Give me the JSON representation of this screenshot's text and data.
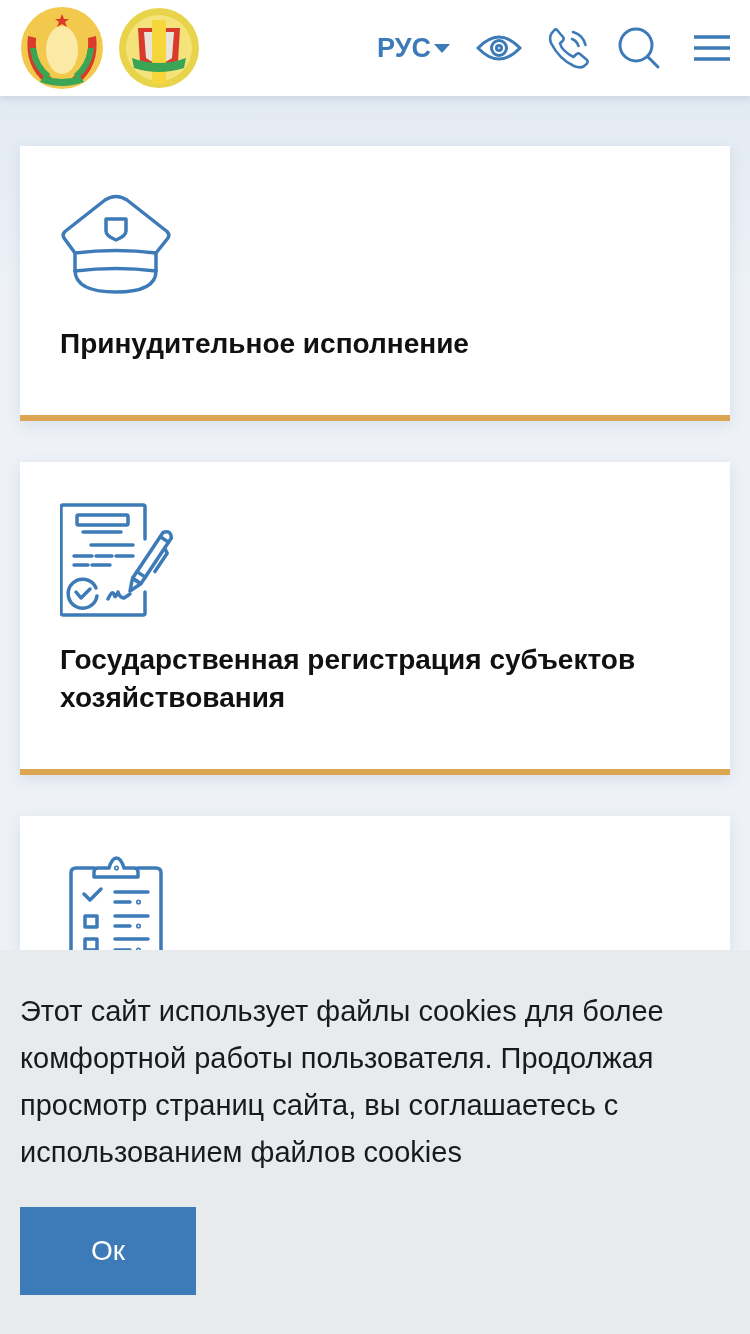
{
  "header": {
    "language": "РУС"
  },
  "cards": [
    {
      "kind": "cap",
      "title": "Принудительное исполнение"
    },
    {
      "kind": "document",
      "title": "Государственная регистрация субъектов хозяйствования"
    },
    {
      "kind": "checklist"
    }
  ],
  "cookie_banner": {
    "text": "Этот сайт использует файлы cookies для более комфортной работы пользователя. Продолжая просмотр страниц сайта, вы соглашаетесь с использованием файлов cookies",
    "button": "Ок"
  }
}
